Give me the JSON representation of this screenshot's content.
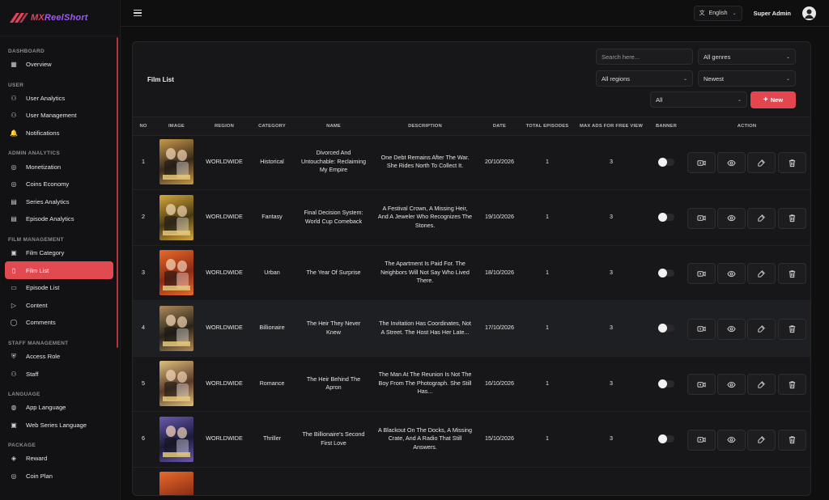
{
  "brand": {
    "name_part1": "MX",
    "name_part2": "ReelShort"
  },
  "sidebar": {
    "sections": [
      {
        "title": "DASHBOARD",
        "items": [
          {
            "label": "Overview",
            "icon": "grid-icon"
          }
        ]
      },
      {
        "title": "USER",
        "items": [
          {
            "label": "User Analytics",
            "icon": "users-icon"
          },
          {
            "label": "User Management",
            "icon": "users-icon"
          },
          {
            "label": "Notifications",
            "icon": "bell-icon"
          }
        ]
      },
      {
        "title": "ADMIN ANALYTICS",
        "items": [
          {
            "label": "Monetization",
            "icon": "coins-icon"
          },
          {
            "label": "Coins Economy",
            "icon": "coins-icon"
          },
          {
            "label": "Series Analytics",
            "icon": "layers-icon"
          },
          {
            "label": "Episode Analytics",
            "icon": "layers-icon"
          }
        ]
      },
      {
        "title": "FILM MANAGEMENT",
        "items": [
          {
            "label": "Film Category",
            "icon": "film-icon"
          },
          {
            "label": "Film List",
            "icon": "clipboard-icon",
            "active": true
          },
          {
            "label": "Episode List",
            "icon": "file-icon"
          },
          {
            "label": "Content",
            "icon": "video-icon"
          },
          {
            "label": "Comments",
            "icon": "comment-icon"
          }
        ]
      },
      {
        "title": "STAFF MANAGEMENT",
        "items": [
          {
            "label": "Access Role",
            "icon": "shield-icon"
          },
          {
            "label": "Staff",
            "icon": "users-icon"
          }
        ]
      },
      {
        "title": "LANGUAGE",
        "items": [
          {
            "label": "App Language",
            "icon": "globe-icon"
          },
          {
            "label": "Web Series Language",
            "icon": "film-icon"
          }
        ]
      },
      {
        "title": "PACKAGE",
        "items": [
          {
            "label": "Reward",
            "icon": "gift-icon"
          },
          {
            "label": "Coin Plan",
            "icon": "coins-icon"
          }
        ]
      }
    ]
  },
  "topbar": {
    "language": "English",
    "admin_name": "Super Admin"
  },
  "filmlist": {
    "title": "Film List",
    "search_placeholder": "Search here...",
    "genre_select": "All genres",
    "region_select": "All regions",
    "sort_select": "Newest",
    "status_select": "All",
    "new_button": "New"
  },
  "table": {
    "headers": [
      "NO",
      "IMAGE",
      "REGION",
      "CATEGORY",
      "NAME",
      "DESCRIPTION",
      "DATE",
      "TOTAL EPISODES",
      "MAX ADS FOR FREE VIEW",
      "BANNER",
      "ACTION"
    ],
    "rows": [
      {
        "no": "1",
        "region": "WORLDWIDE",
        "category": "Historical",
        "name": "Divorced And Untouchable: Reclaiming My Empire",
        "description": "One Debt Remains After The War. She Rides North To Collect It.",
        "date": "20/10/2026",
        "episodes": "1",
        "max_ads": "3",
        "poster_colors": [
          "#3a2a1c",
          "#c79a4a"
        ]
      },
      {
        "no": "2",
        "region": "WORLDWIDE",
        "category": "Fantasy",
        "name": "Final Decision System: World Cup Comeback",
        "description": "A Festival Crown, A Missing Heir, And A Jeweler Who Recognizes The Stones.",
        "date": "19/10/2026",
        "episodes": "1",
        "max_ads": "3",
        "poster_colors": [
          "#4a3a14",
          "#d4a93a"
        ]
      },
      {
        "no": "3",
        "region": "WORLDWIDE",
        "category": "Urban",
        "name": "The Year Of Surprise",
        "description": "The Apartment Is Paid For. The Neighbors Will Not Say Who Lived There.",
        "date": "18/10/2026",
        "episodes": "1",
        "max_ads": "3",
        "poster_colors": [
          "#8a2a14",
          "#e86a2a"
        ]
      },
      {
        "no": "4",
        "region": "WORLDWIDE",
        "category": "Billionaire",
        "name": "The Heir They Never Knew",
        "description": "The Invitation Has Coordinates, Not A Street. The Host Has Her Late...",
        "date": "17/10/2026",
        "episodes": "1",
        "max_ads": "3",
        "poster_colors": [
          "#2a2418",
          "#b08a5a"
        ]
      },
      {
        "no": "5",
        "region": "WORLDWIDE",
        "category": "Romance",
        "name": "The Heir Behind The Apron",
        "description": "The Man At The Reunion Is Not The Boy From The Photograph. She Still Has...",
        "date": "16/10/2026",
        "episodes": "1",
        "max_ads": "3",
        "poster_colors": [
          "#5a3a2a",
          "#e0c07a"
        ]
      },
      {
        "no": "6",
        "region": "WORLDWIDE",
        "category": "Thriller",
        "name": "The Billionaire's Second First Love",
        "description": "A Blackout On The Docks, A Missing Crate, And A Radio That Still Answers.",
        "date": "15/10/2026",
        "episodes": "1",
        "max_ads": "3",
        "poster_colors": [
          "#1a1a3a",
          "#6a5ab0"
        ]
      }
    ]
  },
  "colors": {
    "accent": "#e4454f",
    "background": "#0f0f10",
    "card": "#171719"
  }
}
